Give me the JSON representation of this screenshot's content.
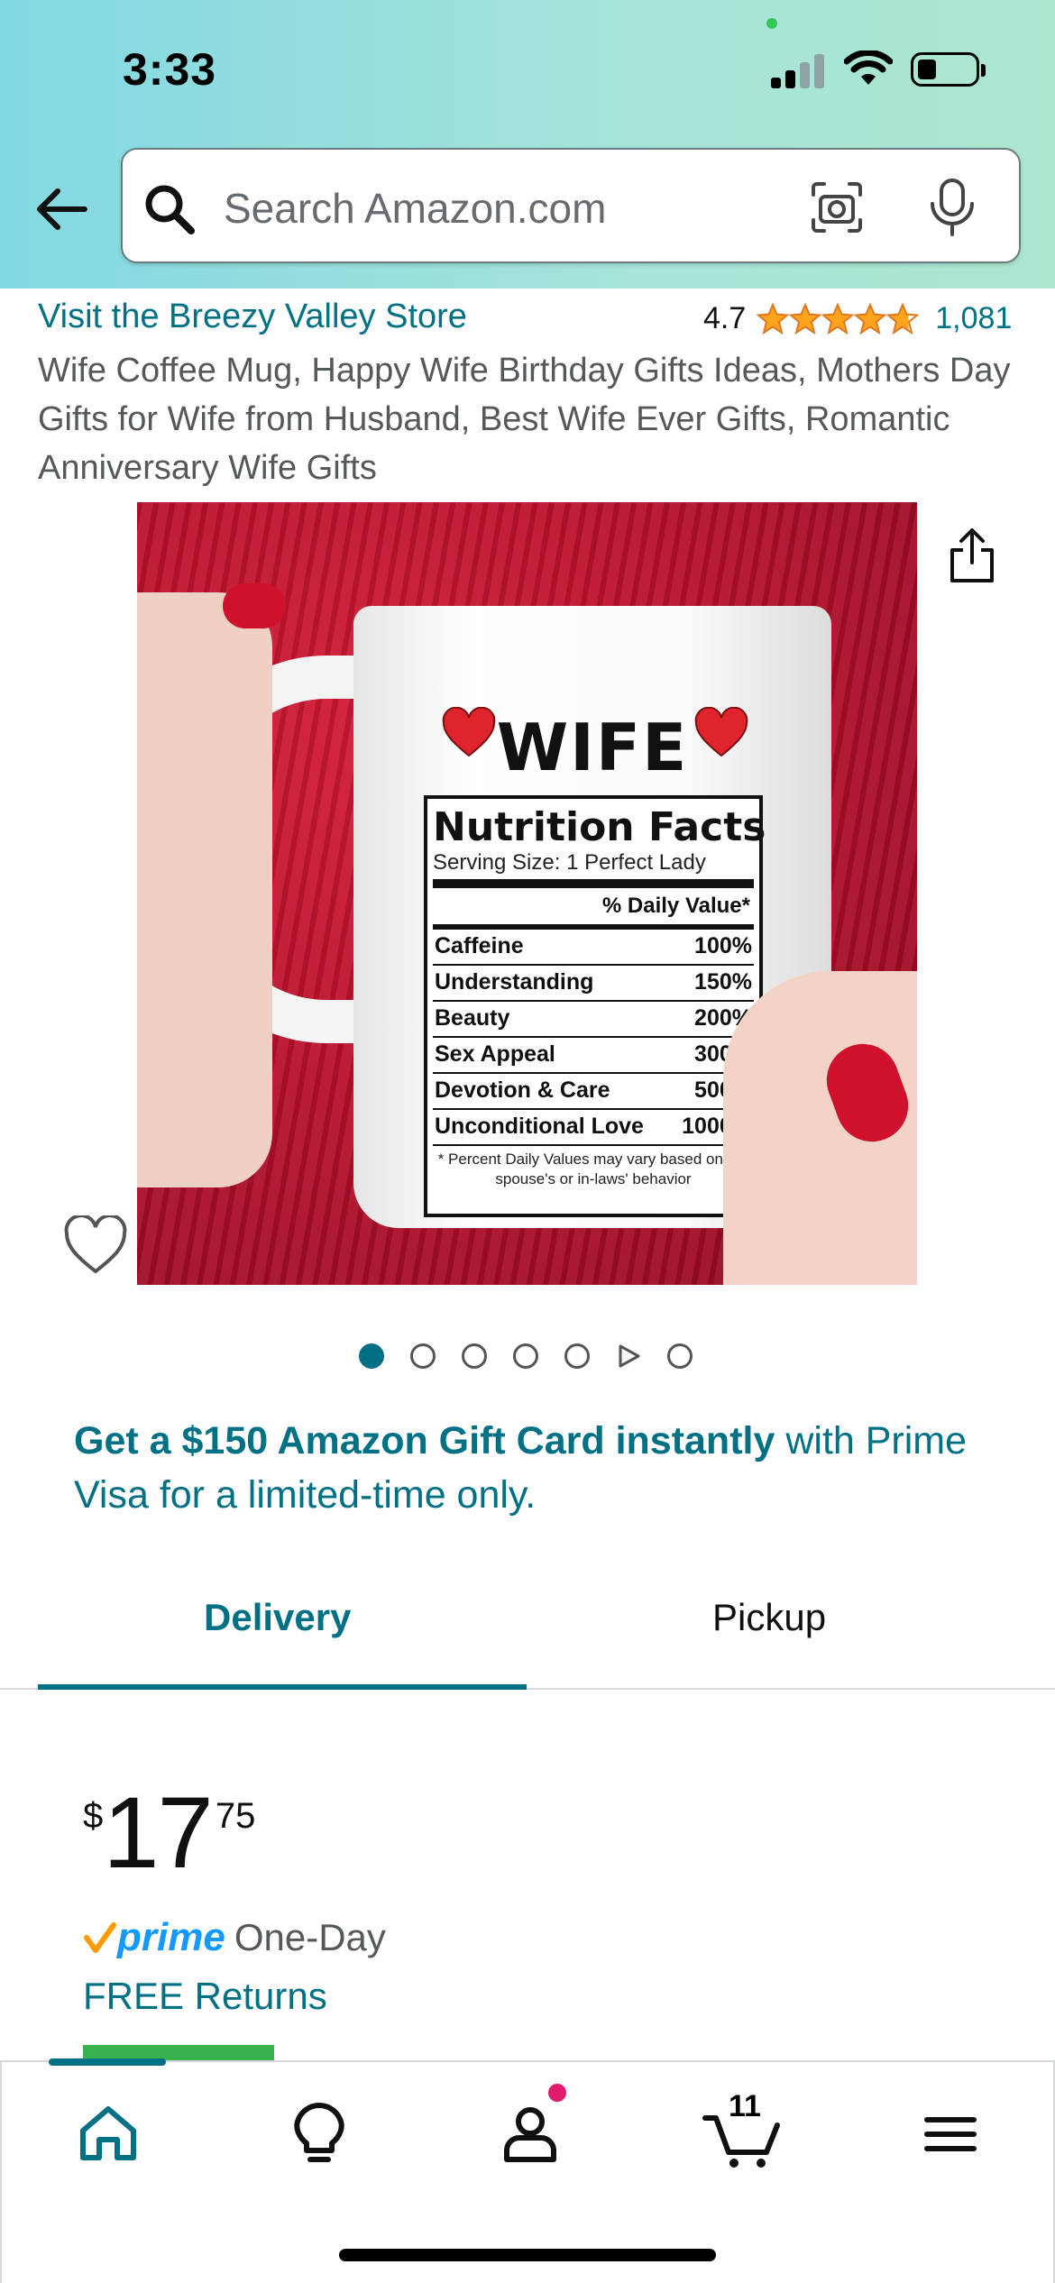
{
  "status_bar": {
    "time": "3:33"
  },
  "search": {
    "placeholder": "Search Amazon.com"
  },
  "product": {
    "store_link": "Visit the Breezy Valley Store",
    "rating": "4.7",
    "rating_stars": 4.7,
    "rating_count": "1,081",
    "title": "Wife Coffee Mug, Happy Wife Birthday Gifts Ideas, Mothers Day Gifts for Wife from Husband, Best Wife Ever Gifts, Romantic Anniversary Wife Gifts"
  },
  "image": {
    "mug_word": "WIFE",
    "nf_title": "Nutrition Facts",
    "nf_serving": "Serving Size: 1 Perfect Lady",
    "nf_dv_header": "% Daily Value*",
    "nf_rows": [
      {
        "label": "Caffeine",
        "value": "100%"
      },
      {
        "label": "Understanding",
        "value": "150%"
      },
      {
        "label": "Beauty",
        "value": "200%"
      },
      {
        "label": "Sex Appeal",
        "value": "300%"
      },
      {
        "label": "Devotion & Care",
        "value": "500%"
      },
      {
        "label": "Unconditional Love",
        "value": "1000%"
      }
    ],
    "nf_note": "* Percent Daily Values may vary based on the spouse's or in-laws' behavior"
  },
  "carousel": {
    "count": 7,
    "active_index": 0,
    "video_index": 5
  },
  "promo": {
    "bold_text": "Get a $150 Amazon Gift Card instantly",
    "rest_text": " with Prime Visa for a limited-time only."
  },
  "tabs": {
    "delivery": "Delivery",
    "pickup": "Pickup",
    "active": "delivery"
  },
  "price": {
    "symbol": "$",
    "whole": "17",
    "fraction": "75"
  },
  "shipping": {
    "prime_label": "prime",
    "speed": "One-Day",
    "returns": "FREE Returns"
  },
  "bottom_nav": {
    "cart_count": "11"
  },
  "colors": {
    "accent": "#007185",
    "star": "#ffa41c",
    "prime_blue": "#1399ff",
    "prime_check": "#ff9900",
    "badge_pink": "#e31b6d"
  }
}
